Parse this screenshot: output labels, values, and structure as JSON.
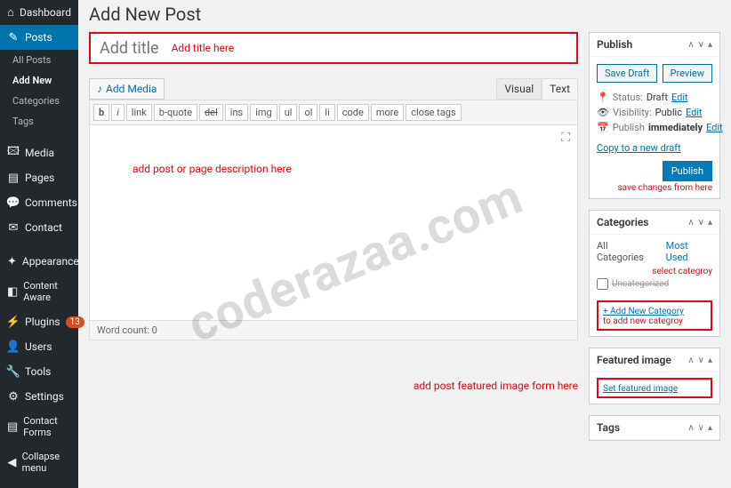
{
  "page": {
    "title": "Add New Post"
  },
  "title_field": {
    "placeholder": "Add title",
    "annotation": "Add title here"
  },
  "sidebar": {
    "items": [
      {
        "icon": "⌂",
        "label": "Dashboard"
      },
      {
        "icon": "✎",
        "label": "Posts"
      },
      {
        "icon": "🖾",
        "label": "Media"
      },
      {
        "icon": "▤",
        "label": "Pages"
      },
      {
        "icon": "💬",
        "label": "Comments"
      },
      {
        "icon": "✉",
        "label": "Contact"
      },
      {
        "icon": "✦",
        "label": "Appearance"
      },
      {
        "icon": "◧",
        "label": "Content Aware"
      },
      {
        "icon": "⚡",
        "label": "Plugins",
        "badge": "13"
      },
      {
        "icon": "👤",
        "label": "Users"
      },
      {
        "icon": "🔧",
        "label": "Tools"
      },
      {
        "icon": "⚙",
        "label": "Settings"
      },
      {
        "icon": "▤",
        "label": "Contact Forms"
      },
      {
        "icon": "◀",
        "label": "Collapse menu"
      }
    ],
    "subs": [
      "All Posts",
      "Add New",
      "Categories",
      "Tags"
    ]
  },
  "media_button": "Add Media",
  "editor": {
    "tabs": {
      "visual": "Visual",
      "text": "Text"
    },
    "buttons": [
      "b",
      "i",
      "link",
      "b-quote",
      "del",
      "ins",
      "img",
      "ul",
      "ol",
      "li",
      "code",
      "more",
      "close tags"
    ],
    "annotation": "add post  or page description here",
    "status": "Word count: 0"
  },
  "publish": {
    "title": "Publish",
    "save_draft": "Save Draft",
    "preview": "Preview",
    "status_label": "Status:",
    "status_value": "Draft",
    "vis_label": "Visibility:",
    "vis_value": "Public",
    "pub_label": "Publish",
    "pub_value": "immediately",
    "edit": "Edit",
    "copy_link": "Copy to a new draft",
    "publish_btn": "Publish",
    "ann": "save changes from here"
  },
  "categories": {
    "title": "Categories",
    "tab_all": "All Categories",
    "tab_most": "Most Used",
    "ann_select": "select categroy",
    "item": "Uncategorized",
    "add_link": "+ Add New Category",
    "ann_add": "to add new categroy"
  },
  "featured": {
    "title": "Featured image",
    "link": "Set featured image",
    "ann": "add post featured image form here"
  },
  "tags_box": {
    "title": "Tags"
  },
  "watermark": "coderazaa.com"
}
